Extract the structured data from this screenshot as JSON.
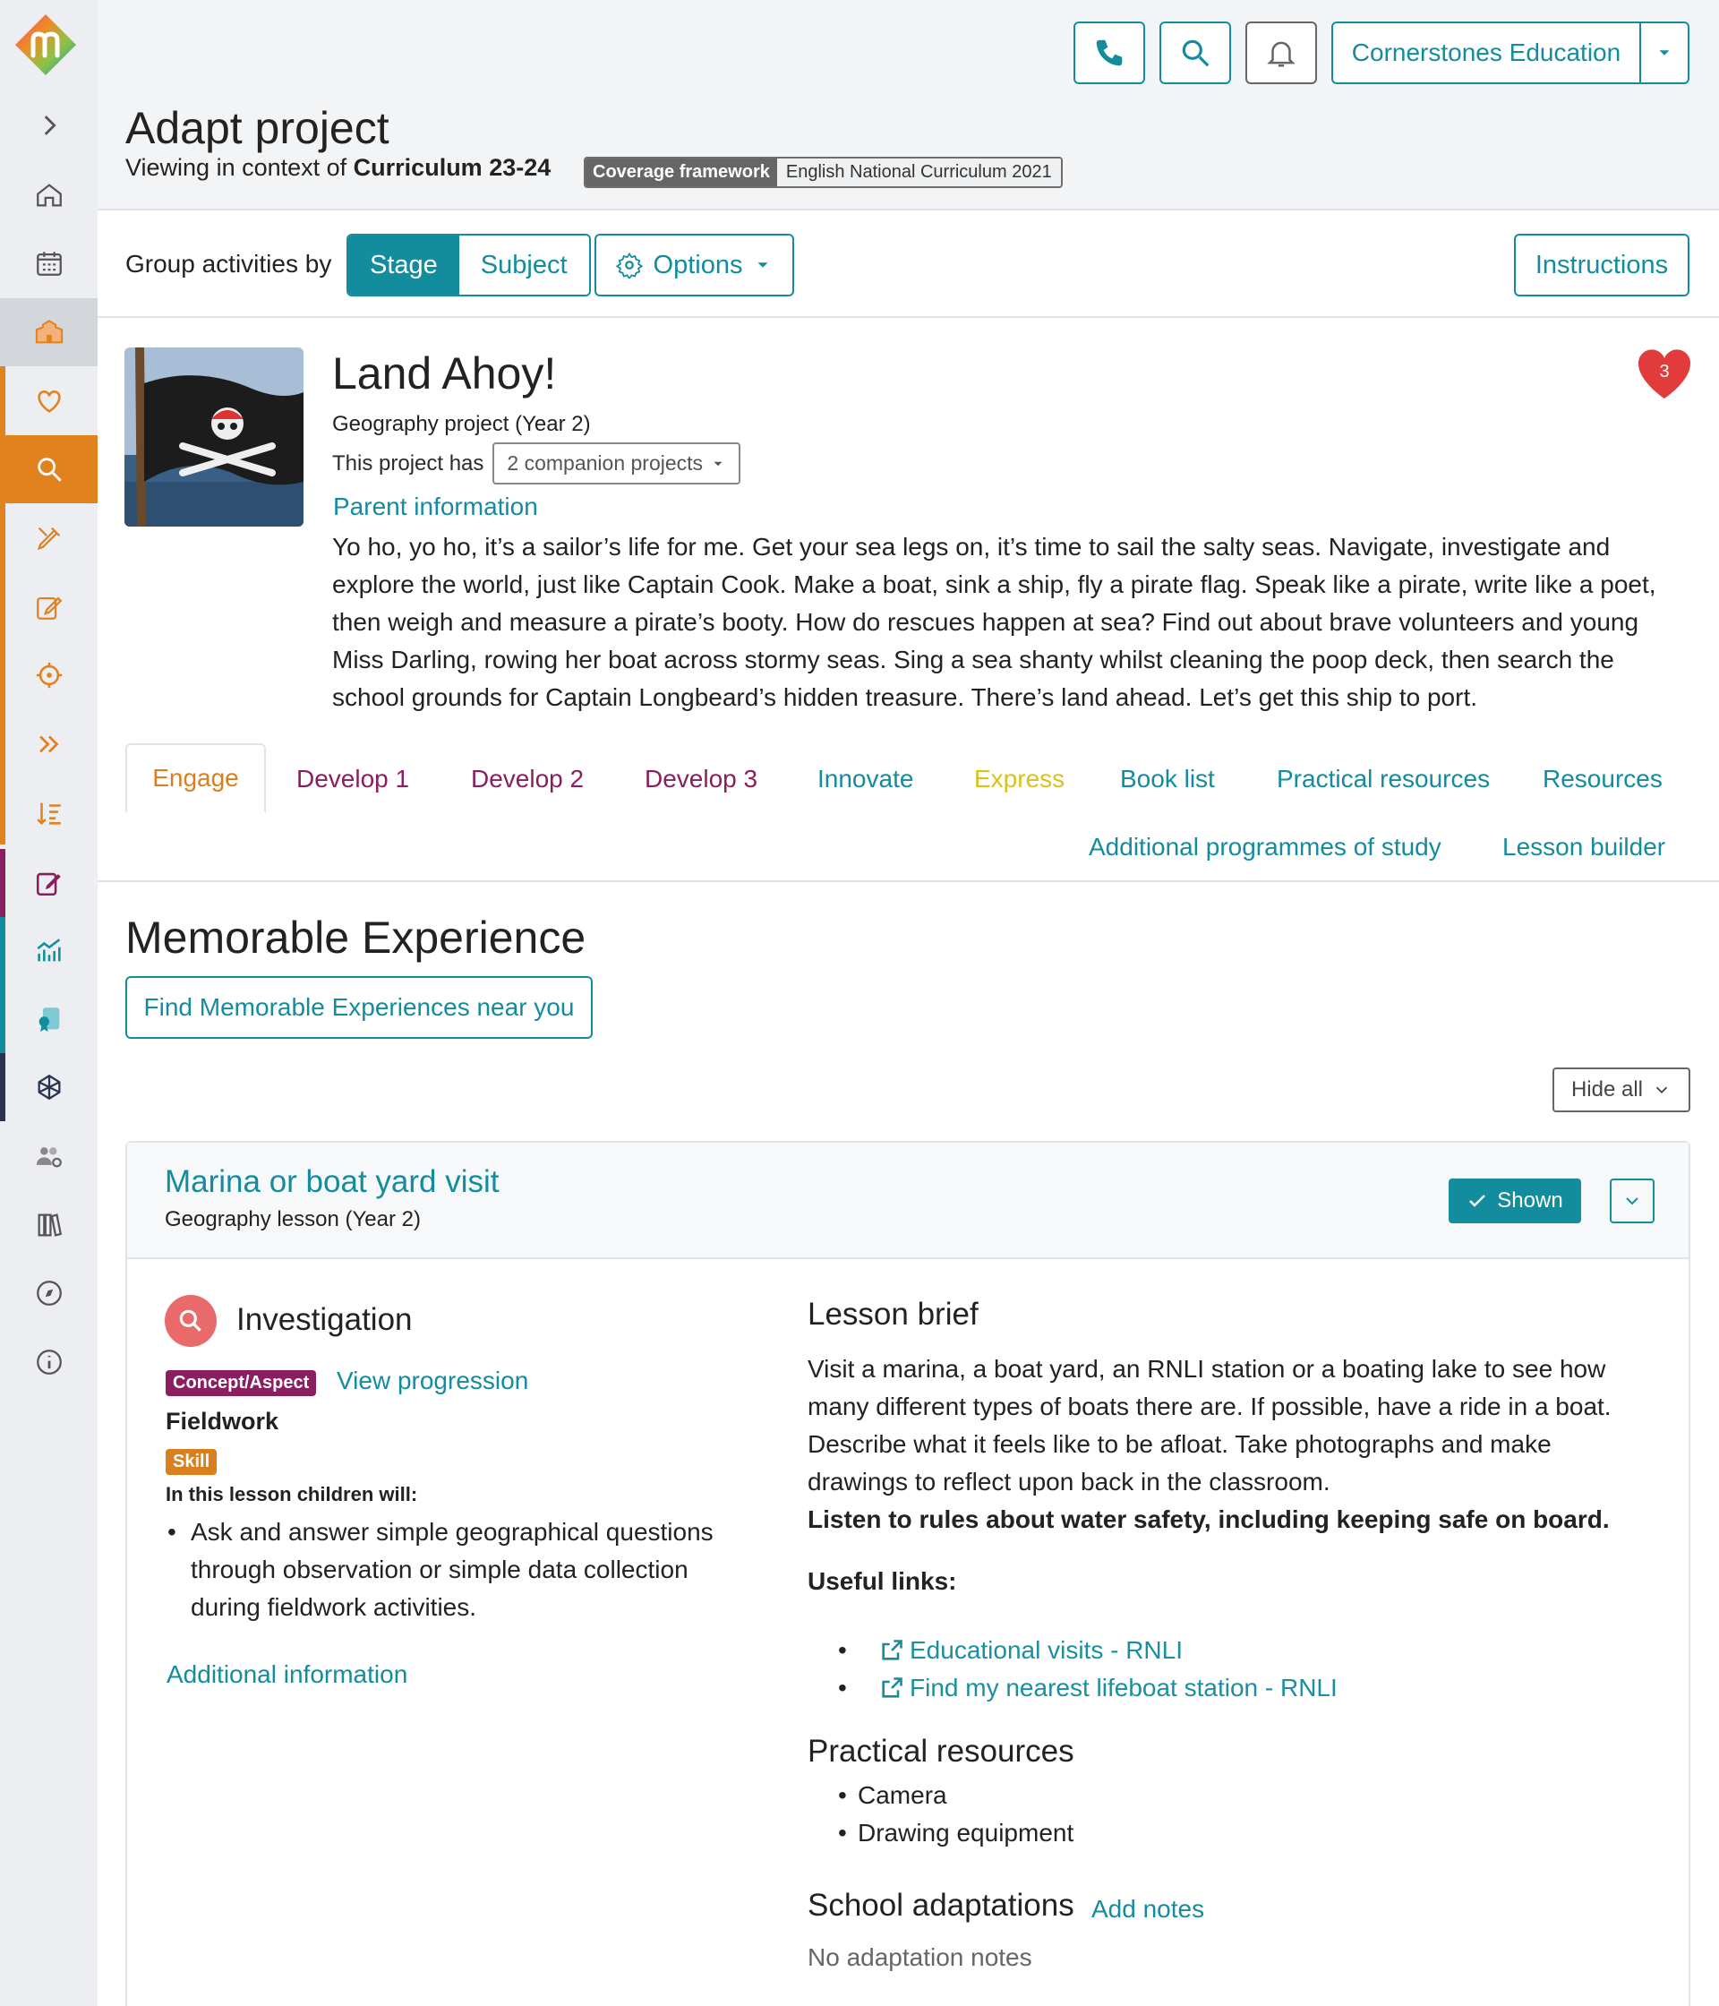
{
  "header": {
    "org_name": "Cornerstones Education",
    "page_title": "Adapt project",
    "context_prefix": "Viewing in context of",
    "context_value": "Curriculum 23-24",
    "coverage_key": "Coverage framework",
    "coverage_value": "English National Curriculum 2021"
  },
  "groupbar": {
    "label": "Group activities by",
    "stage": "Stage",
    "subject": "Subject",
    "options": "Options",
    "instructions": "Instructions"
  },
  "project": {
    "title": "Land Ahoy!",
    "subtitle": "Geography project (Year 2)",
    "companion_prefix": "This project has",
    "companion_btn": "2 companion projects",
    "parent_info": "Parent information",
    "favourite_count": "3",
    "description": "Yo ho, yo ho, it’s a sailor’s life for me. Get your sea legs on, it’s time to sail the salty seas. Navigate, investigate and explore the world, just like Captain Cook. Make a boat, sink a ship, fly a pirate flag. Speak like a pirate, write like a poet, then weigh and measure a pirate’s booty. How do rescues happen at sea? Find out about brave volunteers and young Miss Darling, rowing her boat across stormy seas. Sing a sea shanty whilst cleaning the poop deck, then search the school grounds for Captain Longbeard’s hidden treasure. There’s land ahead. Let’s get this ship to port."
  },
  "tabs": [
    {
      "label": "Engage",
      "color": "#d97f1e"
    },
    {
      "label": "Develop 1",
      "color": "#8a1e5f"
    },
    {
      "label": "Develop 2",
      "color": "#8a1e5f"
    },
    {
      "label": "Develop 3",
      "color": "#8a1e5f"
    },
    {
      "label": "Innovate",
      "color": "#138c9e"
    },
    {
      "label": "Express",
      "color": "#d9c21a"
    },
    {
      "label": "Book list",
      "color": "#138c9e"
    },
    {
      "label": "Practical resources",
      "color": "#138c9e"
    },
    {
      "label": "Resources",
      "color": "#138c9e"
    },
    {
      "label": "Additional programmes of study",
      "color": "#138c9e"
    },
    {
      "label": "Lesson builder",
      "color": "#138c9e"
    }
  ],
  "section": {
    "title": "Memorable Experience",
    "find_btn": "Find Memorable Experiences near you",
    "hide_all": "Hide all"
  },
  "lesson": {
    "title": "Marina or boat yard visit",
    "subtitle": "Geography lesson (Year 2)",
    "shown": "Shown",
    "investigation": "Investigation",
    "concept_badge": "Concept/Aspect",
    "view_progression": "View progression",
    "fieldwork": "Fieldwork",
    "skill_badge": "Skill",
    "will_label": "In this lesson children will:",
    "will_items": [
      "Ask and answer simple geographical questions through observation or simple data collection during fieldwork activities."
    ],
    "additional_info": "Additional information",
    "brief_title": "Lesson brief",
    "brief_text": "Visit a marina, a boat yard, an RNLI station or a boating lake to see how many different types of boats there are. If possible, have a ride in a boat. Describe what it feels like to be afloat. Take photographs and make drawings to reflect upon back in the classroom.",
    "brief_bold": "Listen to rules about water safety, including keeping safe on board.",
    "useful_label": "Useful links:",
    "links": [
      "Educational visits - RNLI",
      "Find my nearest lifeboat station - RNLI"
    ],
    "pr_title": "Practical resources",
    "pr_items": [
      "Camera",
      "Drawing equipment"
    ],
    "sa_title": "School adaptations",
    "add_notes": "Add notes",
    "no_notes": "No adaptation notes"
  },
  "sidebar": {
    "icons": [
      "chevron-right-icon",
      "home-icon",
      "calendar-icon",
      "school-icon",
      "heart-icon",
      "search-icon",
      "pencil-ruler-icon",
      "edit-icon",
      "target-icon",
      "double-chevron-icon",
      "sort-icon",
      "note-icon",
      "chart-icon",
      "certificate-icon",
      "network-icon",
      "users-settings-icon",
      "library-icon",
      "compass-icon",
      "info-icon"
    ]
  },
  "colors": {
    "accent": "#138c9e",
    "engage": "#d97f1e",
    "develop": "#8a1e5f",
    "express": "#d9c21a",
    "heart": "#e23b3b"
  }
}
